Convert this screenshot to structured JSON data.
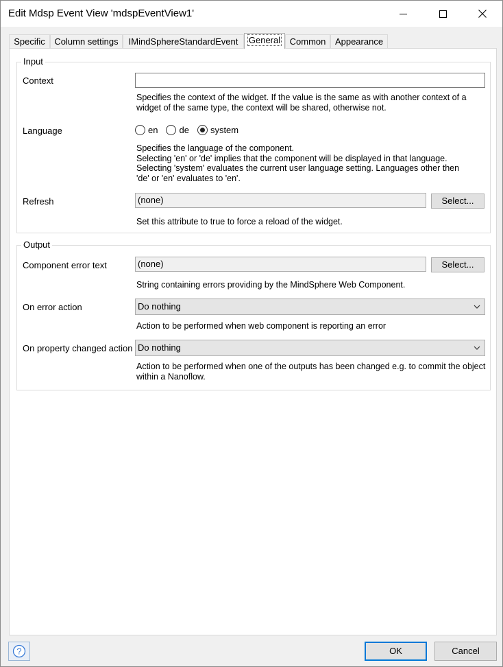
{
  "window": {
    "title": "Edit Mdsp Event View 'mdspEventView1'"
  },
  "tabs": [
    {
      "label": "Specific"
    },
    {
      "label": "Column settings"
    },
    {
      "label": "IMindSphereStandardEvent"
    },
    {
      "label": "General",
      "active": true
    },
    {
      "label": "Common"
    },
    {
      "label": "Appearance"
    }
  ],
  "input_group": {
    "title": "Input",
    "context": {
      "label": "Context",
      "value": "",
      "description": "Specifies the context of the widget. If the value is the same as with another context of a widget of the same type, the context will be shared, otherwise not."
    },
    "language": {
      "label": "Language",
      "options": [
        "en",
        "de",
        "system"
      ],
      "selected": "system",
      "description_lines": [
        "Specifies the language of the component.",
        "Selecting 'en' or 'de' implies that the component will be displayed in that language.",
        "Selecting 'system' evaluates the current user language setting. Languages other then",
        "'de' or 'en' evaluates to 'en'."
      ]
    },
    "refresh": {
      "label": "Refresh",
      "value": "(none)",
      "button": "Select...",
      "description": "Set this attribute to true to force a reload of the widget."
    }
  },
  "output_group": {
    "title": "Output",
    "component_error_text": {
      "label": "Component error text",
      "value": "(none)",
      "button": "Select...",
      "description": "String containing errors providing by the MindSphere Web Component."
    },
    "on_error_action": {
      "label": "On error action",
      "value": "Do nothing",
      "description": "Action to be performed when web component is reporting an error"
    },
    "on_property_changed_action": {
      "label": "On property changed action",
      "value": "Do nothing",
      "description": "Action to be performed when one of the outputs has been changed e.g. to commit the object within a Nanoflow."
    }
  },
  "footer": {
    "help_icon": "?",
    "ok_label": "OK",
    "cancel_label": "Cancel"
  },
  "colors": {
    "accent": "#0078d7",
    "panel_bg": "#ffffff",
    "dialog_bg": "#f0f0f0"
  }
}
